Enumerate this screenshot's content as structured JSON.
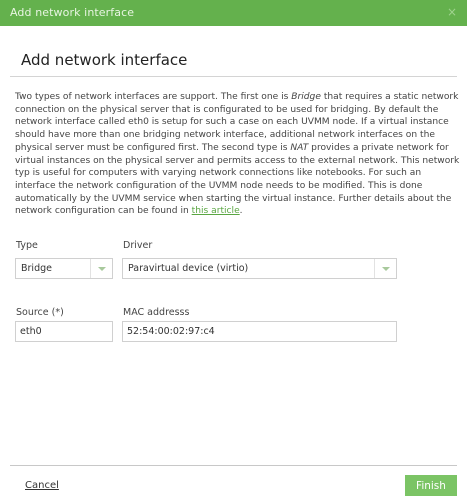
{
  "dialog": {
    "window_title": "Add network interface",
    "close_glyph": "×",
    "heading": "Add network interface"
  },
  "description": {
    "intro": "Two types of network interfaces are support. The first one is ",
    "bridge_term": "Bridge",
    "mid1": " that requires a static network connection on the physical server that is configurated to be used for bridging. By default the network interface called eth0 is setup for such a case on each UVMM node. If a virtual instance should have more than one bridging network interface, additional network interfaces on the physical server must be configured first. The second type is ",
    "nat_term": "NAT",
    "mid2": " provides a private network for virtual instances on the physical server and permits access to the external network. This network typ is useful for computers with varying network connections like notebooks. For such an interface the network configuration of the UVMM node needs to be modified. This is done automatically by the UVMM service when starting the virtual instance. Further details about the network configuration can be found in ",
    "link_text": "this article",
    "end": "."
  },
  "form": {
    "type_label": "Type",
    "type_value": "Bridge",
    "driver_label": "Driver",
    "driver_value": "Paravirtual device (virtio)",
    "source_label": "Source (*)",
    "source_value": "eth0",
    "mac_label": "MAC addresss",
    "mac_value": "52:54:00:02:97:c4"
  },
  "footer": {
    "cancel_label": "Cancel",
    "finish_label": "Finish"
  },
  "colors": {
    "titlebar": "#64b14d",
    "finish_button": "#7bc465",
    "link": "#5aa642"
  },
  "icons": {
    "close": "close-icon",
    "select_arrow": "chevron-down-icon"
  }
}
